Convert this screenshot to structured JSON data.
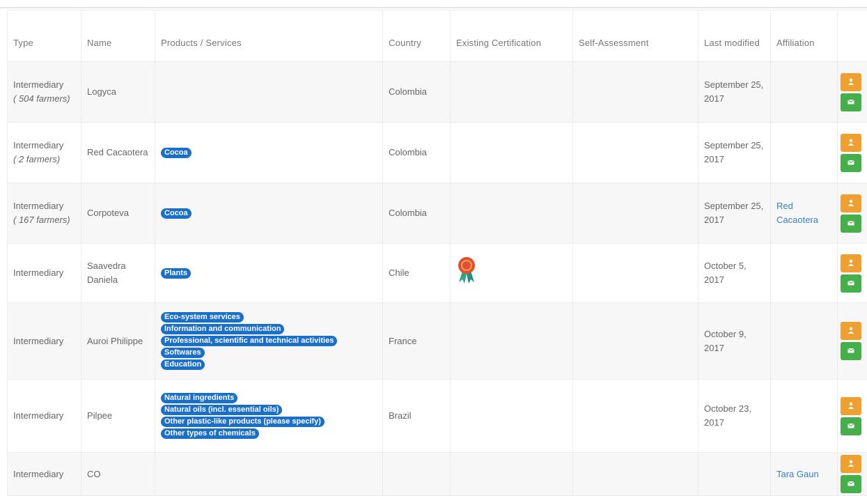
{
  "headers": {
    "type": "Type",
    "name": "Name",
    "products": "Products / Services",
    "country": "Country",
    "certification": "Existing Certification",
    "self_assessment": "Self-Assessment",
    "last_modified": "Last modified",
    "affiliation": "Affiliation"
  },
  "rows": [
    {
      "type": "Intermediary",
      "sub": "( 504 farmers)",
      "name": "Logyca",
      "products": [],
      "country": "Colombia",
      "certified": false,
      "date": "September 25, 2017",
      "affiliation": ""
    },
    {
      "type": "Intermediary",
      "sub": "( 2 farmers)",
      "name": "Red Cacaotera",
      "products": [
        "Cocoa"
      ],
      "country": "Colombia",
      "certified": false,
      "date": "September 25, 2017",
      "affiliation": ""
    },
    {
      "type": "Intermediary",
      "sub": "( 167 farmers)",
      "name": "Corpoteva",
      "products": [
        "Cocoa"
      ],
      "country": "Colombia",
      "certified": false,
      "date": "September 25, 2017",
      "affiliation": "Red Cacaotera"
    },
    {
      "type": "Intermediary",
      "sub": "",
      "name": "Saavedra Daniela",
      "products": [
        "Plants"
      ],
      "country": "Chile",
      "certified": true,
      "date": "October 5, 2017",
      "affiliation": ""
    },
    {
      "type": "Intermediary",
      "sub": "",
      "name": "Auroi Philippe",
      "products": [
        "Eco-system services",
        "Information and communication",
        "Professional, scientific and technical activities",
        "Softwares",
        "Education"
      ],
      "country": "France",
      "certified": false,
      "date": "October 9, 2017",
      "affiliation": ""
    },
    {
      "type": "Intermediary",
      "sub": "",
      "name": "Pilpee",
      "products": [
        "Natural ingredients",
        "Natural oils (incl. essential oils)",
        "Other plastic-like products (please specify)",
        "Other types of chemicals"
      ],
      "country": "Brazil",
      "certified": false,
      "date": "October 23, 2017",
      "affiliation": ""
    },
    {
      "type": "Intermediary",
      "sub": "",
      "name": "CO",
      "products": [],
      "country": "",
      "certified": false,
      "date": "",
      "affiliation": "Tara Gaun"
    }
  ],
  "colors": {
    "badge": "#1a6fc9",
    "profile_button": "#f0a030",
    "message_button": "#45b04a",
    "link": "#3a7fc1"
  },
  "icons": {
    "profile": "person-icon",
    "message": "envelope-icon",
    "certification": "award-ribbon-icon"
  }
}
